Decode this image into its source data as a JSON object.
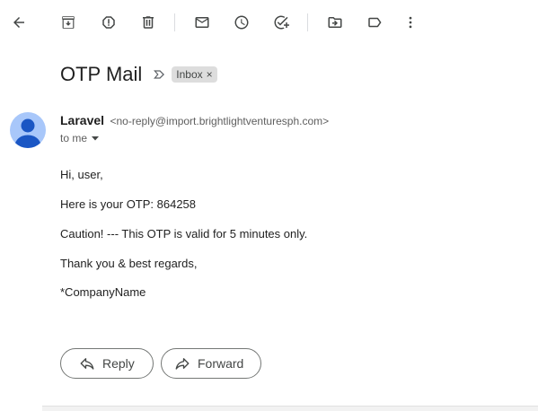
{
  "toolbar": {
    "items": [
      {
        "name": "back-icon"
      },
      {
        "name": "archive-icon"
      },
      {
        "name": "report-spam-icon"
      },
      {
        "name": "delete-icon"
      },
      {
        "name": "mark-unread-icon"
      },
      {
        "name": "snooze-icon"
      },
      {
        "name": "add-task-icon"
      },
      {
        "name": "move-to-icon"
      },
      {
        "name": "labels-icon"
      },
      {
        "name": "more-icon"
      }
    ]
  },
  "email": {
    "subject": "OTP Mail",
    "label": "Inbox",
    "label_close": "×",
    "sender_name": "Laravel",
    "sender_email": "<no-reply@import.brightlightventuresph.com>",
    "to": "to me",
    "body": [
      "Hi, user,",
      "Here is your OTP: 864258",
      "Caution! --- This OTP is valid for 5 minutes only.",
      "Thank you & best regards,",
      "*CompanyName"
    ]
  },
  "actions": {
    "reply_label": "Reply",
    "forward_label": "Forward"
  },
  "colors": {
    "avatar": "#a8c7fa",
    "avatar_figure": "#1a56c4",
    "label_chip": "#dddddd"
  }
}
